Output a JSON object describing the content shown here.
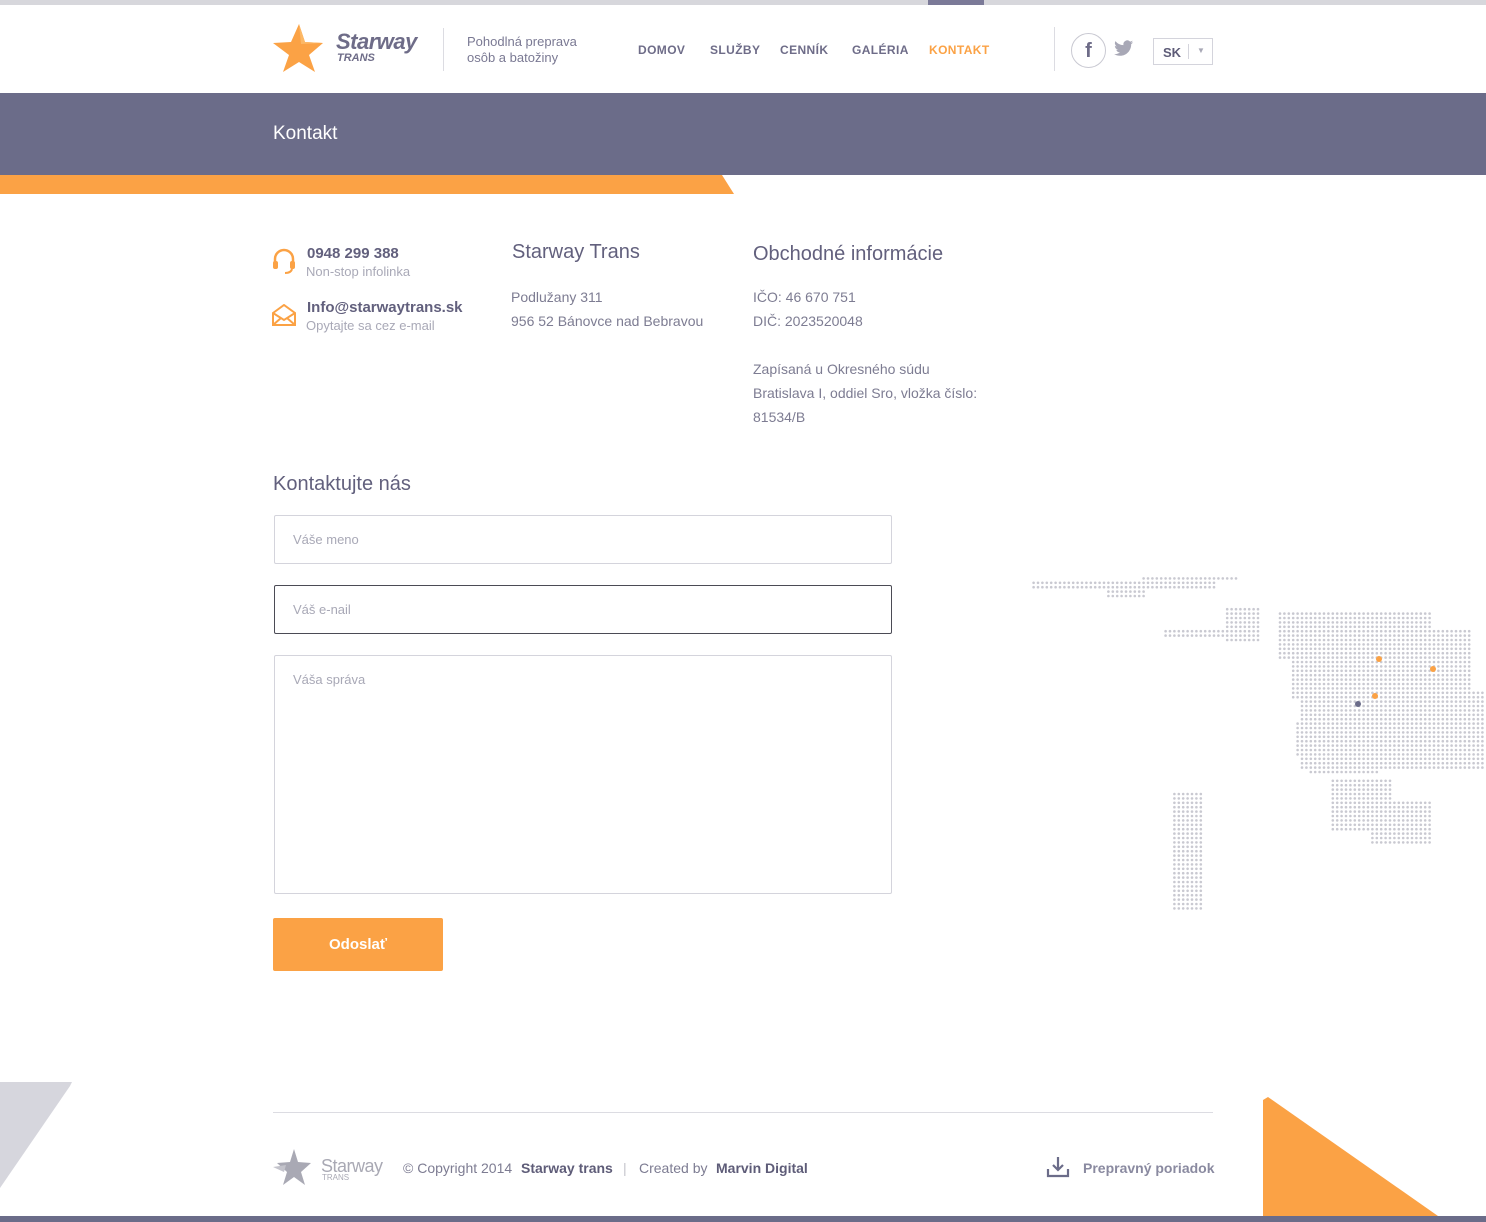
{
  "brand": {
    "name": "Starway",
    "sub": "TRANS",
    "tagline": "Pohodlná preprava osôb a batožiny",
    "accent": "#fba245",
    "primary": "#6b6c89"
  },
  "nav": [
    {
      "label": "DOMOV"
    },
    {
      "label": "SLUŽBY"
    },
    {
      "label": "CENNÍK"
    },
    {
      "label": "GALÉRIA"
    },
    {
      "label": "KONTAKT",
      "active": true
    }
  ],
  "social": {
    "facebook_icon": "f",
    "twitter_icon": "twitter-bird"
  },
  "language": {
    "value": "SK"
  },
  "page": {
    "title": "Kontakt"
  },
  "contact": {
    "phone": "0948 299 388",
    "phone_note": "Non-stop infolinka",
    "email": "Info@starwaytrans.sk",
    "email_note": "Opytajte sa cez e-mail"
  },
  "company": {
    "name": "Starway Trans",
    "street": "Podlužany 311",
    "city": "956 52 Bánovce nad Bebravou"
  },
  "business": {
    "title": "Obchodné informácie",
    "ico": "IČO: 46 670 751",
    "dic": "DIČ: 2023520048",
    "reg1": "Zapísaná u Okresného súdu",
    "reg2": "Bratislava I, oddiel Sro, vložka číslo:",
    "reg3": "81534/B"
  },
  "form": {
    "title": "Kontaktujte nás",
    "name_placeholder": "Váše meno",
    "email_placeholder": "Váš e-nail",
    "message_placeholder": "Váša správa",
    "submit": "Odoslať"
  },
  "footer": {
    "logo_name": "Starway",
    "logo_sub": "TRANS",
    "copyright": "© Copyright 2014",
    "company": "Starway trans",
    "divider": "|",
    "created_by": "Created by",
    "creator": "Marvin Digital",
    "download_label": "Prepravný poriadok"
  }
}
